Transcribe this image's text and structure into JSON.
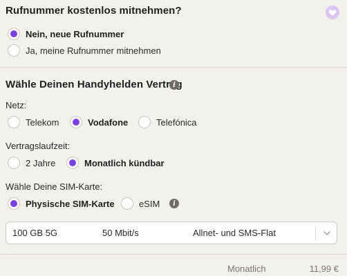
{
  "number_section": {
    "title": "Rufnummer kostenlos mitnehmen?",
    "options": [
      {
        "label": "Nein, neue Rufnummer",
        "checked": true
      },
      {
        "label": "Ja, meine Rufnummer mitnehmen",
        "checked": false
      }
    ]
  },
  "contract_section": {
    "title": "Wähle Deinen Handyhelden Vertrag",
    "info_glyph": "i",
    "network": {
      "label": "Netz:",
      "options": [
        {
          "label": "Telekom",
          "checked": false
        },
        {
          "label": "Vodafone",
          "checked": true
        },
        {
          "label": "Telefónica",
          "checked": false
        }
      ]
    },
    "term": {
      "label": "Vertragslaufzeit:",
      "options": [
        {
          "label": "2 Jahre",
          "checked": false
        },
        {
          "label": "Monatlich kündbar",
          "checked": true
        }
      ]
    },
    "sim": {
      "label": "Wähle Deine SIM-Karte:",
      "options": [
        {
          "label": "Physische SIM-Karte",
          "checked": true
        },
        {
          "label": "eSIM",
          "checked": false
        }
      ]
    },
    "tariff_select": {
      "data_volume": "100 GB 5G",
      "speed": "50 Mbit/s",
      "flat": "Allnet- und SMS-Flat"
    }
  },
  "summary": {
    "label": "Monatlich",
    "price": "11,99 €"
  },
  "colors": {
    "accent": "#7b3fe4",
    "heart_bg": "#d9c6f3",
    "background": "#f3f1ec"
  }
}
